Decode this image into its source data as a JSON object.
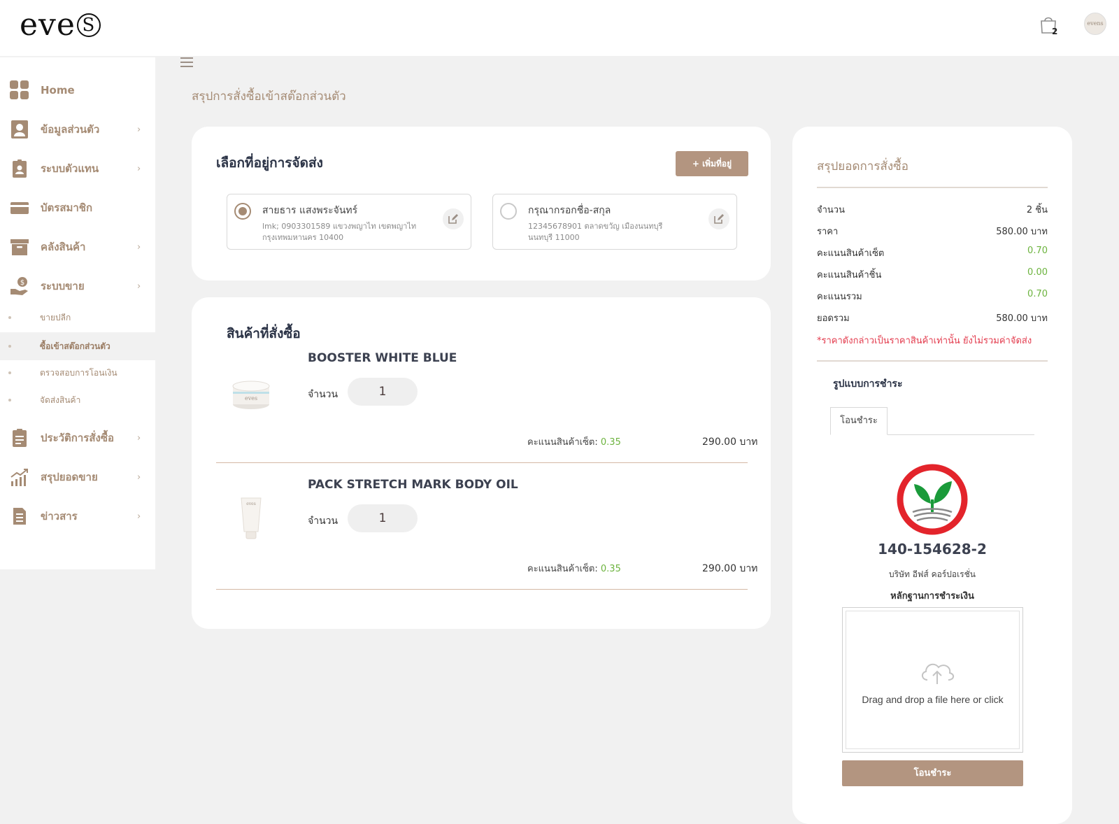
{
  "brand": {
    "logo_text": "eve",
    "logo_mark": "S"
  },
  "header": {
    "cart_count": "2",
    "avatar_text": "evens"
  },
  "sidebar": {
    "items": [
      {
        "label": "Home"
      },
      {
        "label": "ข้อมูลส่วนตัว"
      },
      {
        "label": "ระบบตัวแทน"
      },
      {
        "label": "บัตรสมาชิก"
      },
      {
        "label": "คลังสินค้า"
      },
      {
        "label": "ระบบขาย"
      },
      {
        "label": "ประวัติการสั่งซื้อ"
      },
      {
        "label": "สรุปยอดขาย"
      },
      {
        "label": "ข่าวสาร"
      }
    ],
    "subitems": [
      {
        "label": "ขายปลีก"
      },
      {
        "label": "ซื้อเข้าสต๊อกส่วนตัว"
      },
      {
        "label": "ตรวจสอบการโอนเงิน"
      },
      {
        "label": "จัดส่งสินค้า"
      }
    ],
    "chevron": "›"
  },
  "page": {
    "title": "สรุปการสั่งซื้อเข้าสต๊อกส่วนตัว"
  },
  "address": {
    "title": "เลือกที่อยู่การจัดส่ง",
    "add_button": "+ เพิ่มที่อยู่",
    "options": [
      {
        "name": "สายธาร แสงพระจันทร์",
        "line1": "lmk; 0903301589 แขวงพญาไท เขตพญาไท",
        "line2": "กรุงเทพมหานคร 10400",
        "selected": true
      },
      {
        "name": "กรุณากรอกชื่อ-สกุล",
        "line1": "12345678901 ตลาดขวัญ เมืองนนทบุรี",
        "line2": "นนทบุรี 11000",
        "selected": false
      }
    ]
  },
  "items": {
    "title": "สินค้าที่สั่งซื้อ",
    "qty_label": "จำนวน",
    "points_label": "คะแนนสินค้าเซ็ต:",
    "list": [
      {
        "name": "BOOSTER WHITE BLUE",
        "qty": "1",
        "points": "0.35",
        "price": "290.00 บาท",
        "img_text": "eves"
      },
      {
        "name": "PACK STRETCH MARK BODY OIL",
        "qty": "1",
        "points": "0.35",
        "price": "290.00 บาท",
        "img_text": "eves"
      }
    ]
  },
  "summary": {
    "title": "สรุปยอดการสั่งซื้อ",
    "rows": [
      {
        "label": "จำนวน",
        "value": "2 ชิ้น"
      },
      {
        "label": "ราคา",
        "value": "580.00 บาท"
      },
      {
        "label": "คะแนนสินค้าเซ็ต",
        "value": "0.70"
      },
      {
        "label": "คะแนนสินค้าชิ้น",
        "value": "0.00"
      },
      {
        "label": "คะแนนรวม",
        "value": "0.70"
      },
      {
        "label": "ยอดรวม",
        "value": "580.00 บาท"
      }
    ],
    "note": "*ราคาดังกล่าวเป็นราคาสินค้าเท่านั้น ยังไม่รวมค่าจัดส่ง",
    "payment_title": "รูปแบบการชำระ",
    "payment_tab": "โอนชำระ",
    "account_number": "140-154628-2",
    "account_name": "บริษัท อีฟส์ คอร์ปอเรชั่น",
    "proof_label": "หลักฐานการชำระเงิน",
    "drop_text": "Drag and drop a file here or click",
    "submit_button": "โอนชำระ"
  },
  "colors": {
    "accent": "#b39580",
    "brand_text": "#a58b74",
    "green": "#6cb33e",
    "warning": "#e33b4d",
    "bank_red": "#e3242b",
    "bank_green": "#1a9a3a"
  }
}
